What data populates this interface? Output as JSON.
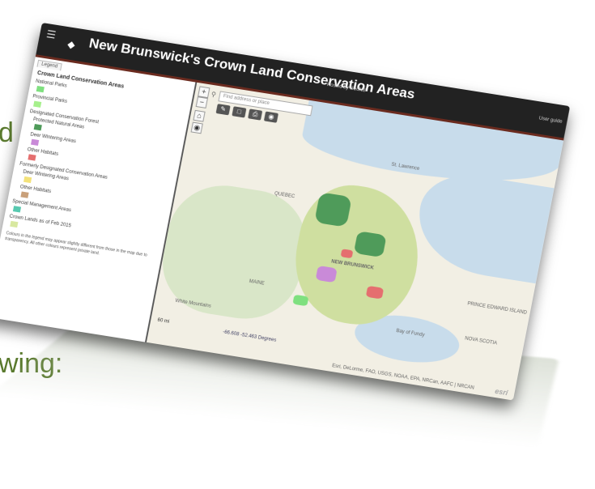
{
  "slide": {
    "fragment_top": "d",
    "fragment_bottom": "wing:"
  },
  "app": {
    "title": "New Brunswick's Crown Land Conservation Areas",
    "hosted_by": "Hosted by GeoNB",
    "user_guide": "User guide"
  },
  "legend": {
    "tab": "Legend",
    "heading": "Crown Land Conservation Areas",
    "national_parks": "National Parks",
    "provincial_parks": "Provincial Parks",
    "designated_group": "Designated Conservation Forest",
    "protected_natural_areas": "Protected Natural Areas",
    "deer_wintering": "Deer Wintering Areas",
    "other_habitats": "Other Habitats",
    "former_group": "Formerly Designated Conservation Areas",
    "former_deer": "Deer Wintering Areas",
    "former_other": "Other Habitats",
    "special_management": "Special Management Areas",
    "crown_lands": "Crown Lands as of Feb 2015",
    "note": "Colours in the legend may appear slightly different from those in the map due to transparency. All other colours represent private land."
  },
  "colors": {
    "national_parks": "#7fe07f",
    "provincial_parks": "#a6f08c",
    "protected_natural_areas": "#4f9b5a",
    "deer_wintering": "#c98ad8",
    "other_habitats": "#e56f6f",
    "former_deer": "#f3e27a",
    "former_other": "#c9a07a",
    "special_management": "#58c9b0",
    "crown_lands": "#d8e8a0"
  },
  "map": {
    "search_placeholder": "Find address or place",
    "scale_label": "60 mi",
    "coords": "-66.608 -52.463 Degrees",
    "attribution": "Esri, DeLorme, FAO, USGS, NOAA, EPA, NRCan, AAFC | NRCAN",
    "esri": "esri",
    "labels": {
      "st_lawrence": "St. Lawrence",
      "quebec": "QUEBEC",
      "maine": "MAINE",
      "new_brunswick": "NEW BRUNSWICK",
      "nova_scotia": "NOVA SCOTIA",
      "pei": "PRINCE EDWARD ISLAND",
      "white_mountains": "White Mountains",
      "bay_of_fundy": "Bay of Fundy"
    }
  }
}
